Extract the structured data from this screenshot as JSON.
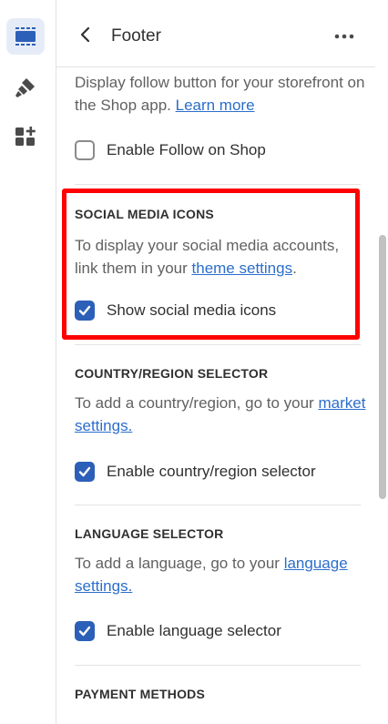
{
  "header": {
    "title": "Footer"
  },
  "rail": {
    "items": [
      "sections-icon",
      "theme-settings-icon",
      "apps-icon"
    ]
  },
  "shop": {
    "description": "Display follow button for your storefront on the Shop app.",
    "link": "Learn more",
    "checkbox_label": "Enable Follow on Shop",
    "checked": false
  },
  "social": {
    "heading": "SOCIAL MEDIA ICONS",
    "description": "To display your social media accounts, link them in your",
    "link": "theme settings",
    "checkbox_label": "Show social media icons",
    "checked": true
  },
  "country": {
    "heading": "COUNTRY/REGION SELECTOR",
    "description": "To add a country/region, go to your",
    "link": "market settings.",
    "checkbox_label": "Enable country/region selector",
    "checked": true
  },
  "language": {
    "heading": "LANGUAGE SELECTOR",
    "description": "To add a language, go to your",
    "link": "language settings.",
    "checkbox_label": "Enable language selector",
    "checked": true
  },
  "payment": {
    "heading": "PAYMENT METHODS"
  },
  "colors": {
    "accent": "#2c5fb8",
    "link": "#2c6ecb",
    "highlight": "#ff0000"
  }
}
